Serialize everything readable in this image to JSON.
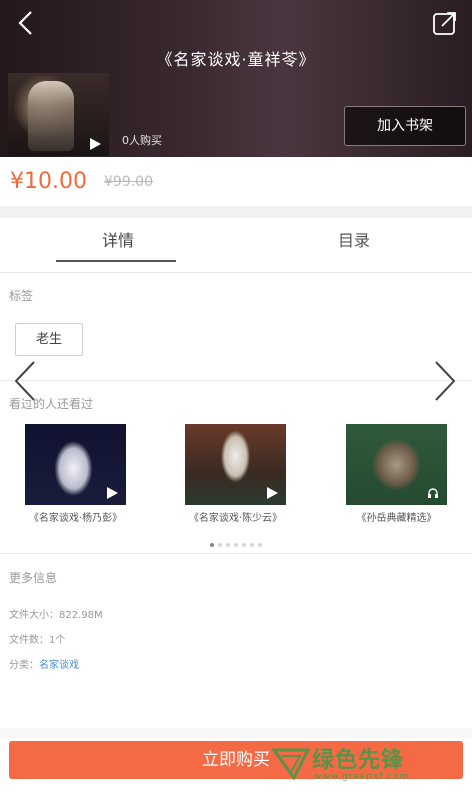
{
  "header": {
    "title": "《名家谈戏·童祥苓》",
    "buyers": "0人购买",
    "add_shelf": "加入书架"
  },
  "price": {
    "current": "¥10.00",
    "original": "¥99.00"
  },
  "tabs": [
    {
      "label": "详情"
    },
    {
      "label": "目录"
    }
  ],
  "tags": {
    "label": "标签",
    "items": [
      "老生"
    ]
  },
  "also_viewed": {
    "label": "看过的人还看过",
    "items": [
      {
        "title": "《名家谈戏·杨乃彭》"
      },
      {
        "title": "《名家谈戏·陈少云》"
      },
      {
        "title": "《孙岳典藏精选》"
      }
    ],
    "page_count": 7,
    "active_page": 1
  },
  "more_info": {
    "label": "更多信息",
    "file_size": "文件大小：822.98M",
    "file_count": "文件数：1个",
    "category_label": "分类：",
    "category_value": "名家谈戏"
  },
  "buy": {
    "label": "立即购买"
  },
  "watermark": {
    "text": "绿色先锋",
    "url": "www.greenxf.com"
  },
  "colors": {
    "accent": "#f36a44",
    "price": "#f26a3a",
    "link": "#4a8fd0",
    "watermark": "#2e9e4a"
  },
  "icons": [
    "back-icon",
    "share-icon",
    "play-icon",
    "chevron-left-icon",
    "chevron-right-icon"
  ]
}
